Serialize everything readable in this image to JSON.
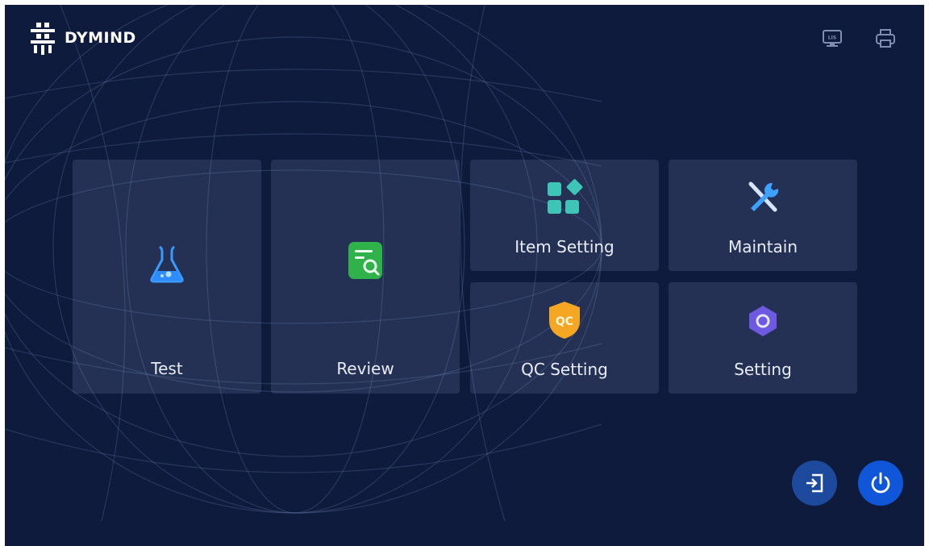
{
  "brand": {
    "name": "DYMIND"
  },
  "header": {
    "icons": [
      {
        "name": "lis-monitor-icon",
        "label": "LIS"
      },
      {
        "name": "printer-icon"
      }
    ]
  },
  "tiles": [
    {
      "id": "test",
      "label": "Test",
      "icon": "flask-icon"
    },
    {
      "id": "review",
      "label": "Review",
      "icon": "review-document-icon"
    },
    {
      "id": "item-setting",
      "label": "Item Setting",
      "icon": "grid-blocks-icon"
    },
    {
      "id": "maintain",
      "label": "Maintain",
      "icon": "wrench-screwdriver-icon"
    },
    {
      "id": "qc-setting",
      "label": "QC Setting",
      "icon": "qc-shield-icon",
      "badge": "QC"
    },
    {
      "id": "setting",
      "label": "Setting",
      "icon": "gear-icon"
    }
  ],
  "footer": {
    "logout": {
      "icon": "logout-icon"
    },
    "power": {
      "icon": "power-icon"
    }
  },
  "colors": {
    "background": "#0f1b3d",
    "tile": "#2a3759",
    "accent_blue": "#0f56d9",
    "logout_blue": "#1d4a9c",
    "review_green": "#2fb24a",
    "teal": "#3fc4b8",
    "qc_orange": "#f5a623",
    "gear_purple": "#6d5ae0"
  }
}
